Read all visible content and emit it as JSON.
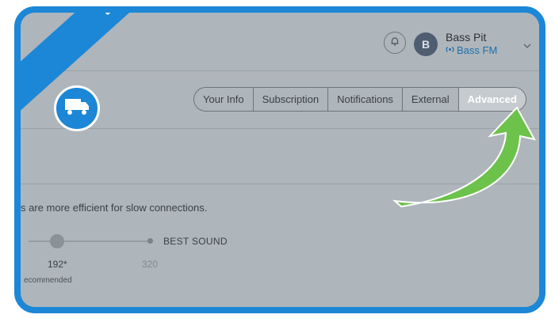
{
  "user": {
    "initial": "B",
    "name": "Bass Pit",
    "station": "Bass FM"
  },
  "tabs": [
    {
      "label": "Your Info",
      "active": false
    },
    {
      "label": "Subscription",
      "active": false
    },
    {
      "label": "Notifications",
      "active": false
    },
    {
      "label": "External",
      "active": false
    },
    {
      "label": "Advanced",
      "active": true
    }
  ],
  "audio": {
    "description": "s are more efficient for slow connections.",
    "best_label": "BEST SOUND",
    "selected_value": "192*",
    "max_value": "320",
    "recommended_label": "ecommended",
    "slider_level_fraction": 0.2
  },
  "ribbon": {
    "count": "3"
  },
  "colors": {
    "accent_blue": "#1b87d6",
    "arrow_green": "#6cc24a",
    "overlay_gray": "#aeb5bb"
  }
}
